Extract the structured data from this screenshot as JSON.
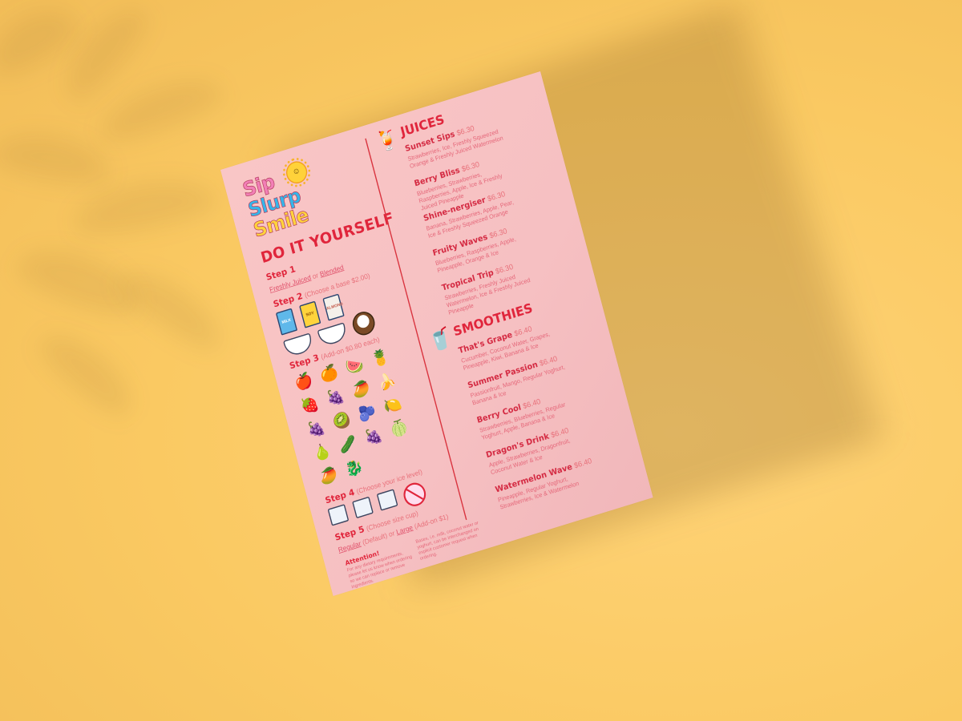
{
  "logo": {
    "line1": "Sip",
    "line2": "Slurp",
    "line3": "Smile",
    "sun_face": "☺"
  },
  "diy": {
    "title": "DO IT YOURSELF",
    "step1": {
      "label": "Step 1",
      "option_a": "Freshly Juiced",
      "or": " or ",
      "option_b": "Blended"
    },
    "step2": {
      "label": "Step 2",
      "note": "(Choose a base $2.00)",
      "bases": [
        "MILK",
        "SOY",
        "ALMOND"
      ]
    },
    "step3": {
      "label": "Step 3",
      "note": "(Add-on $0.80 each)"
    },
    "step4": {
      "label": "Step 4",
      "note": "(Choose your ice level)"
    },
    "step5": {
      "label": "Step 5",
      "note": "(Choose size cup)",
      "regular": "Regular",
      "default_note": " (Default) or ",
      "large": "Large",
      "addon": " (Add-on $1)"
    }
  },
  "attention": {
    "title": "Attention!",
    "text1": "For any dietary requirements, please let us know when ordering so we can replace or remove ingredients.",
    "text2": "Bases, i.e. milk, coconut water or yoghurt, can be interchanged on explicit customer request when ordering."
  },
  "juices": {
    "title": "JUICES",
    "items": [
      {
        "name": "Sunset Sips",
        "price": "$6.30",
        "desc": "Strawberries, Ice, Freshly Squeezed Orange & Freshly Juiced Watermelon"
      },
      {
        "name": "Berry Bliss",
        "price": "$6.30",
        "desc": "Blueberries, Strawberries, Raspberries, Apple, Ice & Freshly Juiced Pineapple"
      },
      {
        "name": "Shine-nergiser",
        "price": "$6.30",
        "desc": "Banana, Strawberries, Apple, Pear, Ice & Freshly Squeezed Orange"
      },
      {
        "name": "Fruity Waves",
        "price": "$6.30",
        "desc": "Blueberries, Raspberries, Apple, Pineapple, Orange & Ice"
      },
      {
        "name": "Tropical Trip",
        "price": "$6.30",
        "desc": "Strawberries, Freshly Juiced Watermelon, Ice & Freshly Juiced Pineapple"
      }
    ]
  },
  "smoothies": {
    "title": "SMOOTHIES",
    "items": [
      {
        "name": "That's Grape",
        "price": "$6.40",
        "desc": "Cucumber, Coconut Water, Grapes, Pineapple, Kiwi, Banana & Ice"
      },
      {
        "name": "Summer Passion",
        "price": "$6.40",
        "desc": "Passionfruit, Mango, Regular Yoghurt, Banana & Ice"
      },
      {
        "name": "Berry Cool",
        "price": "$6.40",
        "desc": "Strawberries, Blueberries, Regular Yoghurt, Apple, Banana & Ice"
      },
      {
        "name": "Dragon's Drink",
        "price": "$6.40",
        "desc": "Apple, Strawberries, Dragonfruit, Coconut Water & Ice"
      },
      {
        "name": "Watermelon Wave",
        "price": "$6.40",
        "desc": "Pineapple, Regular Yoghurt, Strawberries, Ice & Watermelon"
      }
    ]
  },
  "icons": {
    "cocktail": "🍹",
    "smoothie_glass": "🥤",
    "fruits": [
      "🍎",
      "🍊",
      "🍉",
      "🍍",
      "🍓",
      "🍇",
      "🥭",
      "🍌",
      "🍇",
      "🥝",
      "🫐",
      "🍋",
      "🍐",
      "🥒",
      "🍇",
      "🍈",
      "🥭",
      "🐉"
    ]
  },
  "colors": {
    "background": "#fac962",
    "paper": "#f7c2c4",
    "accent": "#e0263c"
  }
}
